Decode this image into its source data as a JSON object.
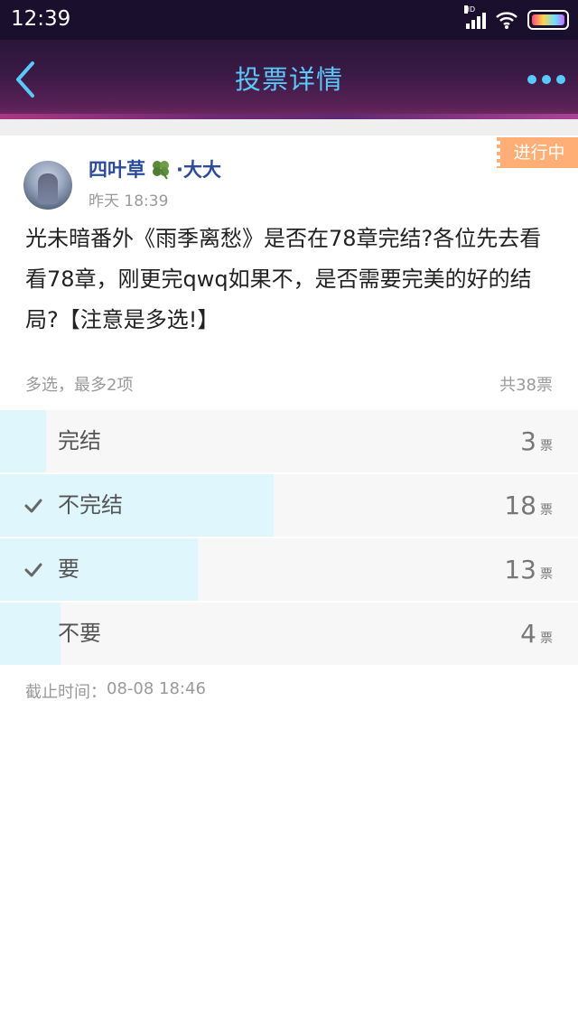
{
  "status_bar": {
    "time": "12:39",
    "network_label": "HD"
  },
  "navbar": {
    "title": "投票详情"
  },
  "post": {
    "status_badge": "进行中",
    "author_name": "四叶草",
    "author_suffix": "·大大",
    "time": "昨天 18:39",
    "question": "光未暗番外《雨季离愁》是否在78章完结?各位先去看看78章，刚更完qwq如果不，是否需要完美的好的结局?【注意是多选!】"
  },
  "poll": {
    "rules": "多选，最多2项",
    "total": "共38票",
    "options": [
      {
        "label": "完结",
        "count": "3",
        "unit": "票",
        "selected": false,
        "share": 0.079
      },
      {
        "label": "不完结",
        "count": "18",
        "unit": "票",
        "selected": true,
        "share": 0.474
      },
      {
        "label": "要",
        "count": "13",
        "unit": "票",
        "selected": true,
        "share": 0.342
      },
      {
        "label": "不要",
        "count": "4",
        "unit": "票",
        "selected": false,
        "share": 0.105
      }
    ],
    "deadline_label": "截止时间：",
    "deadline_value": "08-08 18:46"
  },
  "colors": {
    "accent": "#5ac8fa",
    "badge": "#ffae75",
    "bar_fill": "#dff6fd",
    "option_bg": "#f7f7f7",
    "author": "#2b4b9b"
  },
  "icons": [
    "back-arrow-icon",
    "more-dots-icon",
    "check-icon",
    "clover-icon",
    "signal-icon",
    "wifi-icon",
    "battery-icon"
  ]
}
